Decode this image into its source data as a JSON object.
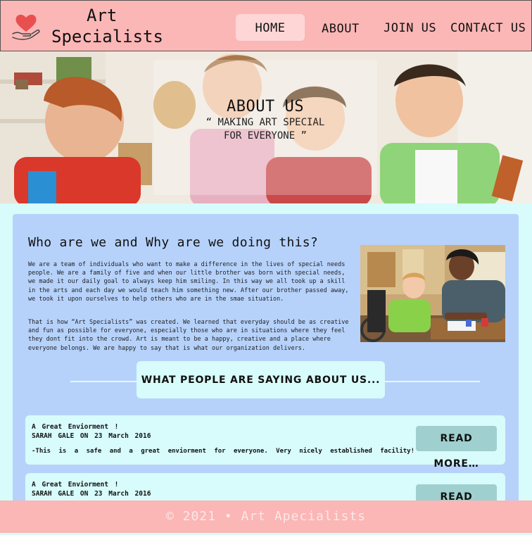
{
  "header": {
    "brand_line1": "Art",
    "brand_line2": "Specialists",
    "nav": {
      "home": "HOME",
      "about": "ABOUT",
      "join": "JOIN US",
      "contact": "CONTACT US"
    }
  },
  "hero": {
    "title": "ABOUT US",
    "subtitle_line1": "“ MAKING ART SPECIAL",
    "subtitle_line2": "FOR EVERYONE ”"
  },
  "about": {
    "heading": "Who are we and Why are we doing this?",
    "paragraph1": "We are a team of individuals who want to make a difference in the lives of special needs people. We are a family of five and when our little brother was born with special needs, we made it our daily goal to always keep him smiling. In this way we all took up a skill in the arts and each day we would teach him something new. After our brother passed away, we took it upon ourselves to help others who are in the smae situation.",
    "paragraph2": "That is how “Art Specialists” was created. We learned that everyday should be as creative and fun as possible for everyone, especially those who are in situations where they feel they dont fit into the crowd.  Art is meant to be a happy, creative and a place where everyone belongs. We are happy to say that is what our organization delivers."
  },
  "testimonials": {
    "heading": "WHAT PEOPLE ARE SAYING ABOUT US...",
    "items": [
      {
        "title": "A Great Enviorment !",
        "meta": "SARAH GALE ON 23 March 2016",
        "text": "-This is a safe and a great enviorment for everyone. Very nicely established facility!",
        "button": "READ MORE…"
      },
      {
        "title": "A Great Enviorment !",
        "meta": "SARAH GALE ON 23 March 2016",
        "button": "READ MORE…"
      }
    ]
  },
  "footer": {
    "text": "© 2021 • Art Apecialists"
  },
  "colors": {
    "header_bg": "#fbb6b6",
    "page_bg": "#d8fbfb",
    "card_bg": "#b6d2fb",
    "button_bg": "#9fcfcf"
  }
}
